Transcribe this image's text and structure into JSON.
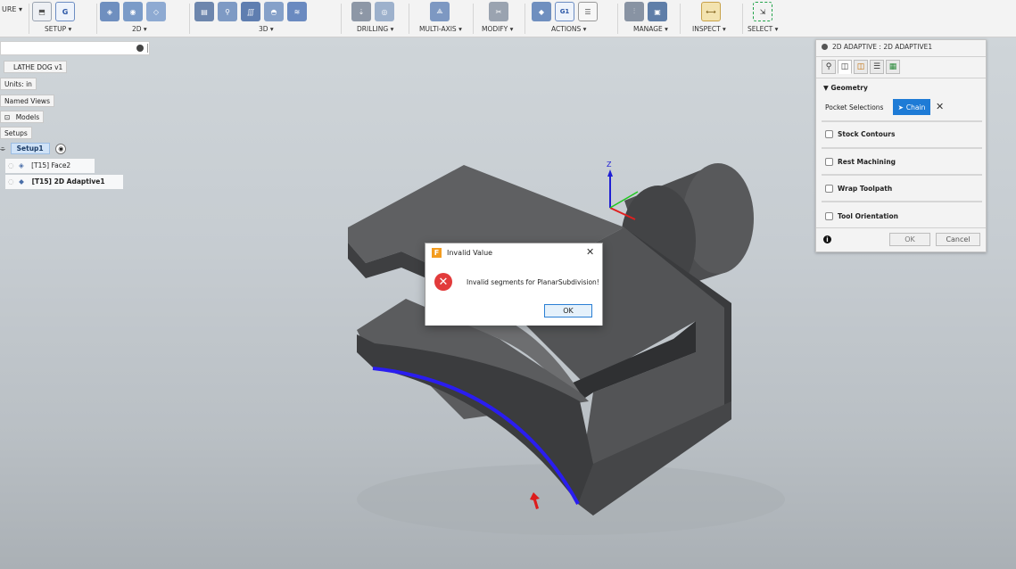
{
  "toolbar": {
    "setup_label": "SETUP ▾",
    "twod_label": "2D ▾",
    "threed_label": "3D ▾",
    "drilling_label": "DRILLING ▾",
    "multiaxis_label": "MULTI-AXIS ▾",
    "modify_label": "MODIFY ▾",
    "actions_label": "ACTIONS ▾",
    "manage_label": "MANAGE ▾",
    "inspect_label": "INSPECT ▾",
    "select_label": "SELECT ▾",
    "workspace_label": "URE ▾"
  },
  "browser": {
    "document": "LATHE DOG v1",
    "units": "Units: in",
    "named_views": "Named Views",
    "models": "Models",
    "setups": "Setups",
    "setup1": "Setup1",
    "op1": "[T15] Face2",
    "op2": "[T15] 2D Adaptive1"
  },
  "panel": {
    "title": "2D ADAPTIVE : 2D ADAPTIVE1",
    "geometry_header": "▼ Geometry",
    "pocket_selections": "Pocket Selections",
    "chain_button": "Chain",
    "stock_contours": "Stock Contours",
    "rest_machining": "Rest Machining",
    "wrap_toolpath": "Wrap Toolpath",
    "tool_orientation": "Tool Orientation",
    "ok": "OK",
    "cancel": "Cancel"
  },
  "dialog": {
    "title": "Invalid Value",
    "message": "Invalid segments for PlanarSubdivision!",
    "ok": "OK"
  },
  "triad": {
    "z_label": "Z"
  },
  "colors": {
    "accent": "#2a7fd4",
    "chain_blue": "#1e7bd6",
    "selection_edge": "#2a1df0",
    "error_red": "#e23b3b"
  }
}
